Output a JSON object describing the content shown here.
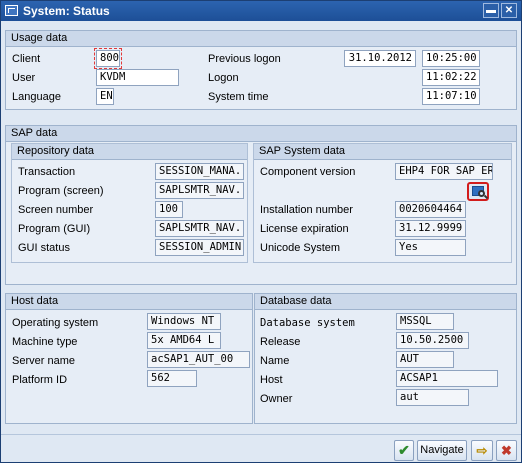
{
  "window": {
    "title": "System: Status"
  },
  "usage": {
    "header": "Usage data",
    "client_label": "Client",
    "client": "800",
    "user_label": "User",
    "user": "KVDM",
    "language_label": "Language",
    "language": "EN",
    "prev_logon_label": "Previous logon",
    "prev_logon_date": "31.10.2012",
    "prev_logon_time": "10:25:00",
    "logon_label": "Logon",
    "logon_time": "11:02:22",
    "system_time_label": "System time",
    "system_time": "11:07:10"
  },
  "sap": {
    "header": "SAP data",
    "repo_header": "Repository data",
    "transaction_label": "Transaction",
    "transaction": "SESSION_MANA...",
    "program_screen_label": "Program (screen)",
    "program_screen": "SAPLSMTR_NAV...",
    "screen_number_label": "Screen number",
    "screen_number": "100",
    "program_gui_label": "Program (GUI)",
    "program_gui": "SAPLSMTR_NAV...",
    "gui_status_label": "GUI status",
    "gui_status": "SESSION_ADMIN",
    "system_header": "SAP System data",
    "component_label": "Component version",
    "component": "EHP4 FOR SAP ER...",
    "install_label": "Installation number",
    "install": "0020604464",
    "license_label": "License expiration",
    "license": "31.12.9999",
    "unicode_label": "Unicode System",
    "unicode": "Yes"
  },
  "host": {
    "header": "Host data",
    "os_label": "Operating system",
    "os": "Windows NT",
    "machine_label": "Machine type",
    "machine": "5x AMD64 L",
    "server_label": "Server name",
    "server": "acSAP1_AUT_00",
    "platform_label": "Platform ID",
    "platform": "562"
  },
  "database": {
    "header": "Database data",
    "system_label": "Database system",
    "system": "MSSQL",
    "release_label": "Release",
    "release": "10.50.2500",
    "name_label": "Name",
    "name": "AUT",
    "host_label": "Host",
    "host": "ACSAP1",
    "owner_label": "Owner",
    "owner": "aut"
  },
  "buttons": {
    "navigate": "Navigate"
  },
  "colors": {
    "titlebar": "#1d4f97",
    "highlight": "#d21c1c",
    "accept": "#2e8b2e",
    "cancel": "#c0392b"
  },
  "icons": [
    "window-menu-icon",
    "minimize-icon",
    "close-icon",
    "technical-info-icon",
    "checkmark-icon",
    "export-icon",
    "cancel-icon"
  ]
}
